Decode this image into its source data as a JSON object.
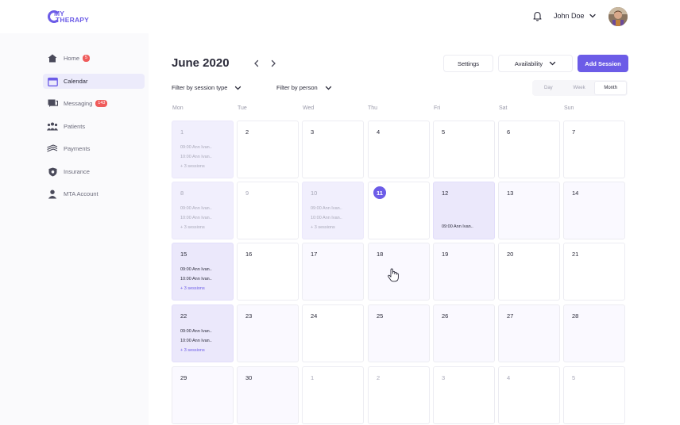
{
  "app": {
    "logo_line1": "MY",
    "logo_line2": "THERAPY"
  },
  "header": {
    "user_name": "John Doe"
  },
  "sidebar": {
    "items": [
      {
        "label": "Home",
        "badge": "5",
        "icon": "home-icon"
      },
      {
        "label": "Calendar",
        "badge": "",
        "icon": "calendar-icon",
        "active": true
      },
      {
        "label": "Messaging",
        "badge": "143",
        "icon": "messaging-icon"
      },
      {
        "label": "Patients",
        "badge": "",
        "icon": "patients-icon"
      },
      {
        "label": "Payments",
        "badge": "",
        "icon": "payments-icon"
      },
      {
        "label": "Insurance",
        "badge": "",
        "icon": "insurance-icon"
      },
      {
        "label": "MTA Account",
        "badge": "",
        "icon": "account-icon"
      }
    ]
  },
  "calendar": {
    "month_title": "June 2020",
    "settings_label": "Settings",
    "availability_label": "Availability",
    "add_session_label": "Add Session",
    "filter_session_type": "Filter by session type",
    "filter_person": "Filter by person",
    "views": [
      "Day",
      "Week",
      "Month"
    ],
    "active_view": "Month",
    "weekdays": [
      "Mon",
      "Tue",
      "Wed",
      "Thu",
      "Fri",
      "Sat",
      "Sun"
    ],
    "weeks": [
      [
        {
          "day": "1",
          "style": "session",
          "faded": true,
          "entries": [
            "09:00 Ann Ivan..",
            "10:00 Ann Ivan.."
          ],
          "more": "+ 3 sessions"
        },
        {
          "day": "2"
        },
        {
          "day": "3"
        },
        {
          "day": "4"
        },
        {
          "day": "5"
        },
        {
          "day": "6"
        },
        {
          "day": "7"
        }
      ],
      [
        {
          "day": "8",
          "style": "session",
          "faded": true,
          "entries": [
            "09:00 Ann Ivan..",
            "10:00 Ann Ivan.."
          ],
          "more": "+ 3 sessions"
        },
        {
          "day": "9",
          "faded": true
        },
        {
          "day": "10",
          "style": "session",
          "faded": true,
          "entries": [
            "09:00 Ann Ivan..",
            "10:00 Ann Ivan.."
          ],
          "more": "+ 3 sessions"
        },
        {
          "day": "11",
          "today": true
        },
        {
          "day": "12",
          "style": "strong",
          "entries": [
            "09:00 Ann Ivan.."
          ]
        },
        {
          "day": "13",
          "style": "light"
        },
        {
          "day": "14",
          "style": "light"
        }
      ],
      [
        {
          "day": "15",
          "style": "strong",
          "entries": [
            "09:00 Ann Ivan..",
            "10:00 Ann Ivan.."
          ],
          "more": "+ 3 sessions"
        },
        {
          "day": "16"
        },
        {
          "day": "17",
          "style": "light"
        },
        {
          "day": "18",
          "style": "light"
        },
        {
          "day": "19",
          "style": "light"
        },
        {
          "day": "20"
        },
        {
          "day": "21"
        }
      ],
      [
        {
          "day": "22",
          "style": "strong",
          "entries": [
            "09:00 Ann Ivan..",
            "10:00 Ann Ivan.."
          ],
          "more": "+ 3 sessions"
        },
        {
          "day": "23",
          "style": "light"
        },
        {
          "day": "24"
        },
        {
          "day": "25",
          "style": "light"
        },
        {
          "day": "26",
          "style": "light"
        },
        {
          "day": "27",
          "style": "light"
        },
        {
          "day": "28",
          "style": "light"
        }
      ],
      [
        {
          "day": "29",
          "style": "light"
        },
        {
          "day": "30",
          "style": "light"
        },
        {
          "day": "1",
          "other": true
        },
        {
          "day": "2",
          "other": true
        },
        {
          "day": "3",
          "other": true
        },
        {
          "day": "4",
          "other": true
        },
        {
          "day": "5",
          "other": true
        }
      ]
    ]
  },
  "colors": {
    "accent": "#6c5ce7",
    "badge": "#ef5b5b",
    "session_bg": "#f1effd",
    "session_strong_bg": "#ebe8fb"
  }
}
